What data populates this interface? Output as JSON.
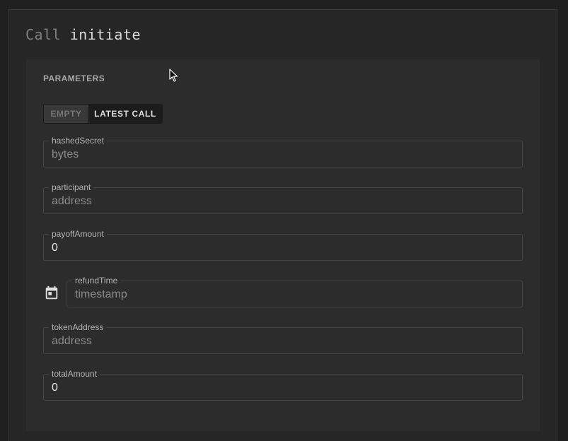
{
  "header": {
    "title_prefix": "Call",
    "title_method": "initiate"
  },
  "parameters": {
    "section_label": "Parameters",
    "toggle": {
      "empty_label": "EMPTY",
      "latest_label": "LATEST CALL",
      "selected": "EMPTY"
    },
    "fields": [
      {
        "label": "hashedSecret",
        "value": "",
        "placeholder": "bytes"
      },
      {
        "label": "participant",
        "value": "",
        "placeholder": "address"
      },
      {
        "label": "payoffAmount",
        "value": "0",
        "placeholder": ""
      },
      {
        "label": "refundTime",
        "value": "",
        "placeholder": "timestamp",
        "icon": "calendar-icon"
      },
      {
        "label": "tokenAddress",
        "value": "",
        "placeholder": "address"
      },
      {
        "label": "totalAmount",
        "value": "0",
        "placeholder": ""
      }
    ]
  },
  "colors": {
    "background": "#202020",
    "card": "#262626",
    "panel": "#2c2c2c",
    "border": "#444444"
  }
}
